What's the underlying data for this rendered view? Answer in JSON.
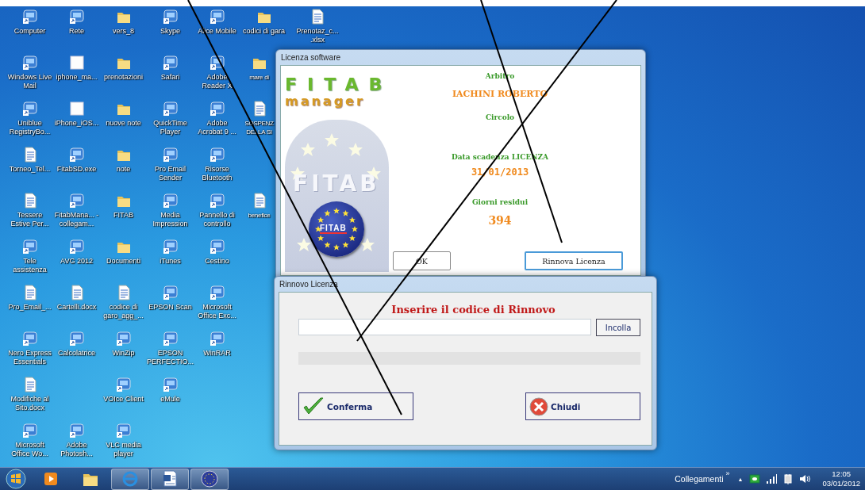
{
  "desktop": {
    "columns": [
      [
        {
          "kind": "program",
          "label": "Computer"
        },
        {
          "kind": "program",
          "label": "Windows Live Mail"
        },
        {
          "kind": "program",
          "label": "Uniblue RegistryBo..."
        },
        {
          "kind": "document",
          "label": "Torneo_Tel..."
        },
        {
          "kind": "document",
          "label": "Tessere Estive Per..."
        },
        {
          "kind": "program",
          "label": "Tele assistenza"
        },
        {
          "kind": "document",
          "label": "Pro_Email_..."
        },
        {
          "kind": "program",
          "label": "Nero Express Essentials"
        },
        {
          "kind": "document",
          "label": "Modifiche al Sito.docx"
        },
        {
          "kind": "program",
          "label": "Microsoft Office Wo..."
        }
      ],
      [
        {
          "kind": "program",
          "label": "Rete"
        },
        {
          "kind": "blank",
          "label": "iphone_ma..."
        },
        {
          "kind": "blank",
          "label": "iPhone_iOS..."
        },
        {
          "kind": "program",
          "label": "FitabSD.exe"
        },
        {
          "kind": "program",
          "label": "FitabMana... - collegam..."
        },
        {
          "kind": "program",
          "label": "AVG 2012"
        },
        {
          "kind": "document",
          "label": "Cartelli.docx"
        },
        {
          "kind": "program",
          "label": "Calcolatrice"
        },
        {
          "kind": "gap"
        },
        {
          "kind": "program",
          "label": "Adobe Photosh..."
        }
      ],
      [
        {
          "kind": "folder",
          "label": "vers_8"
        },
        {
          "kind": "folder",
          "label": "prenotazioni"
        },
        {
          "kind": "folder",
          "label": "nuove note"
        },
        {
          "kind": "folder",
          "label": "note"
        },
        {
          "kind": "folder",
          "label": "FITAB"
        },
        {
          "kind": "folder",
          "label": "Documenti"
        },
        {
          "kind": "document",
          "label": "codice di garo_agg_..."
        },
        {
          "kind": "program",
          "label": "WinZip"
        },
        {
          "kind": "program",
          "label": "VOIce Client"
        },
        {
          "kind": "program",
          "label": "VLC media player"
        }
      ],
      [
        {
          "kind": "program",
          "label": "Skype"
        },
        {
          "kind": "program",
          "label": "Safari"
        },
        {
          "kind": "program",
          "label": "QuickTime Player"
        },
        {
          "kind": "program",
          "label": "Pro Email Sender"
        },
        {
          "kind": "program",
          "label": "Media Impression"
        },
        {
          "kind": "program",
          "label": "iTunes"
        },
        {
          "kind": "program",
          "label": "EPSON Scan"
        },
        {
          "kind": "program",
          "label": "EPSON PERFECTIO..."
        },
        {
          "kind": "program",
          "label": "eMule"
        }
      ],
      [
        {
          "kind": "program",
          "label": "Alice Mobile"
        },
        {
          "kind": "program",
          "label": "Adobe Reader X"
        },
        {
          "kind": "program",
          "label": "Adobe Acrobat 9 ..."
        },
        {
          "kind": "program",
          "label": "Risorse Bluetooth"
        },
        {
          "kind": "program",
          "label": "Pannello di controllo"
        },
        {
          "kind": "program",
          "label": "Cestino"
        },
        {
          "kind": "program",
          "label": "Microsoft Office Exc..."
        },
        {
          "kind": "program",
          "label": "WinRAR"
        }
      ],
      [
        {
          "kind": "folder",
          "label": "codici di gara"
        },
        {
          "kind": "folder",
          "label": "mare di"
        },
        {
          "kind": "document",
          "label": "SOSPENZ DELLA SI"
        },
        {
          "kind": "gap"
        },
        {
          "kind": "document",
          "label": "benefice"
        }
      ],
      [
        {
          "kind": "document",
          "label": "Prenotaz_c... .xlsx"
        }
      ]
    ]
  },
  "license_window": {
    "title": "Licenza software",
    "logo_title": "FITAB",
    "logo_subtitle": "manager",
    "emblem_text": "FITAB",
    "badge_text": "FITAB",
    "fields": [
      {
        "label": "Arbitro",
        "value": "IACHINI ROBERTO"
      },
      {
        "label": "Circolo"
      },
      {
        "label": "Data scadenza LICENZA",
        "value": "31/01/2013"
      },
      {
        "label": "Giorni residui",
        "value": "394"
      }
    ],
    "buttons": [
      {
        "label": "OK",
        "focused": false
      },
      {
        "label": "Rinnova Licenza",
        "focused": true
      }
    ]
  },
  "renew_window": {
    "title": "Rinnovo Licenza",
    "heading": "Inserire il codice di Rinnovo",
    "paste_button": "Incolla",
    "progress": {
      "level": 0
    },
    "buttons": [
      {
        "kind": "confirm",
        "label": "Conferma"
      },
      {
        "kind": "close",
        "label": "Chiudi"
      }
    ]
  },
  "taskbar": {
    "items": [
      {
        "kind": "media",
        "running": false
      },
      {
        "kind": "folder",
        "running": false
      },
      {
        "kind": "browser",
        "running": true
      },
      {
        "kind": "word",
        "running": true
      },
      {
        "kind": "fitab",
        "running": true
      }
    ],
    "toolbar_label": "Collegamenti",
    "toolbar_chevron": "»",
    "tray_arrow": "▲",
    "time": "12:05",
    "date": "03/01/2012"
  }
}
